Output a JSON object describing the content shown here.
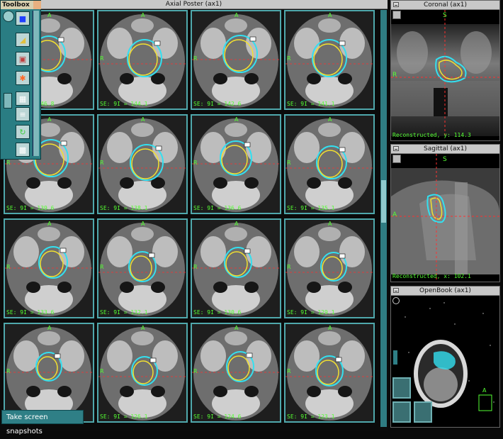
{
  "axial": {
    "title": "Axial Poster (ax1)",
    "slices": [
      {
        "label": "SE: 9I = 146.8"
      },
      {
        "label": "SE: 9I = 144.1"
      },
      {
        "label": "SE: 9I = 142.6"
      },
      {
        "label": "SE: 9I = 141.1"
      },
      {
        "label": "SE: 9I = 139.6"
      },
      {
        "label": "SE: 9I = 138.1"
      },
      {
        "label": "SE: 9I = 136.6"
      },
      {
        "label": "SE: 9I = 135.1"
      },
      {
        "label": "SE: 9I = 133.6"
      },
      {
        "label": "SE: 9I = 132.1"
      },
      {
        "label": "SE: 9I = 130.6"
      },
      {
        "label": "SE: 9I = 129.1"
      },
      {
        "label": "SE: 9I = 127.6"
      },
      {
        "label": "SE: 9I = 126.1"
      },
      {
        "label": "SE: 9I = 124.6"
      },
      {
        "label": "SE: 9I = 123.1"
      }
    ],
    "orient_top": "A",
    "orient_left": "R"
  },
  "toolbox": {
    "title": "Toolbox",
    "tools": [
      {
        "icon": "brain-map-icon"
      },
      {
        "icon": "ruler-icon"
      },
      {
        "icon": "layers-icon"
      },
      {
        "icon": "target-icon"
      },
      {
        "icon": "camera-icon"
      },
      {
        "icon": "film-icon"
      },
      {
        "icon": "rotate-icon"
      },
      {
        "icon": "grid-icon"
      }
    ]
  },
  "coronal": {
    "title": "Coronal (ax1)",
    "orient_top": "S",
    "orient_left": "R",
    "reconstructed": "Reconstructed, y: 114.3"
  },
  "sagittal": {
    "title": "Sagittal (ax1)",
    "orient_top": "S",
    "orient_left": "A",
    "reconstructed": "Reconstructed, x: 102.1"
  },
  "openbook": {
    "title": "OpenBook (ax1)",
    "orient_top": "A"
  },
  "snapshot": {
    "label": "Take screen snapshots"
  },
  "colors": {
    "teal": "#2f7f86",
    "contour_cyan": "#33e0f0",
    "contour_yellow": "#f2e030",
    "label_green": "#55ff33",
    "crosshair_red": "#ff3030"
  }
}
